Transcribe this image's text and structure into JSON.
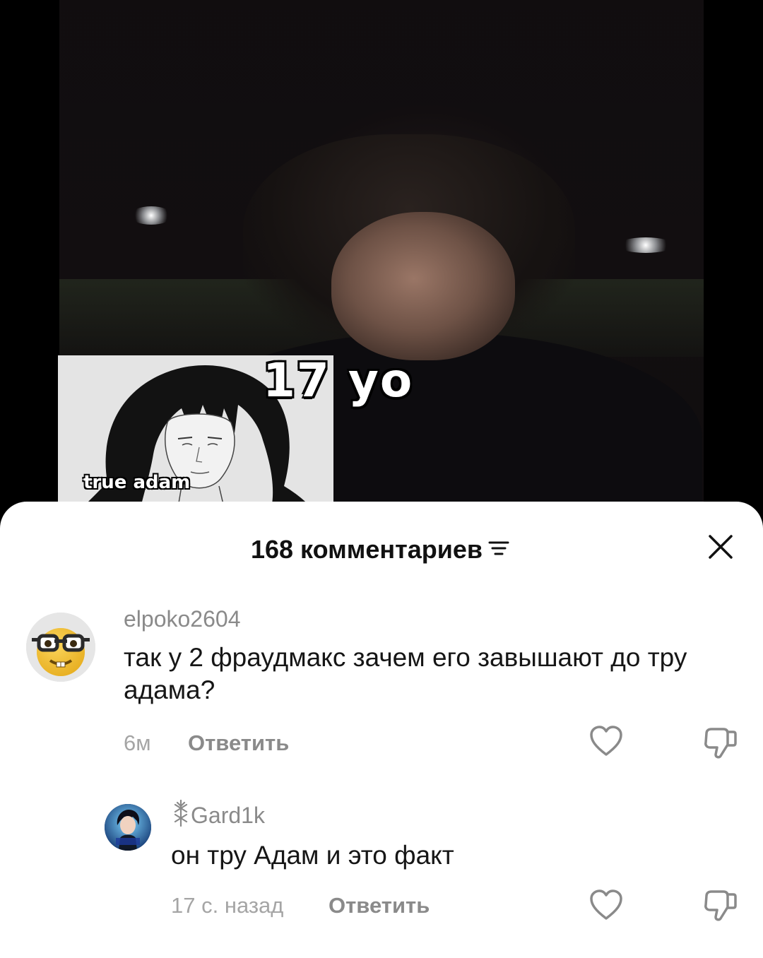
{
  "video": {
    "overlay_text": "17 yo",
    "inset_caption": "true adam"
  },
  "comments_sheet": {
    "title": "168 комментариев",
    "filter_icon": "filter-lines-icon",
    "close_icon": "close-icon",
    "comments": [
      {
        "username": "elpoko2604",
        "text": "так у 2 фраудмакс зачем его завышают до тру адама?",
        "time": "6м",
        "reply_label": "Ответить",
        "avatar": "nerd-emoji-avatar"
      },
      {
        "username": "Gard1k",
        "username_prefix_icon": "berserk-brand-icon",
        "text": "он тру Адам и это факт",
        "time": "17 с. назад",
        "reply_label": "Ответить",
        "avatar": "anime-character-avatar"
      }
    ]
  },
  "colors": {
    "sheet_bg": "#ffffff",
    "username": "#8a8a8a",
    "text": "#161616",
    "time": "#a5a5a5"
  }
}
